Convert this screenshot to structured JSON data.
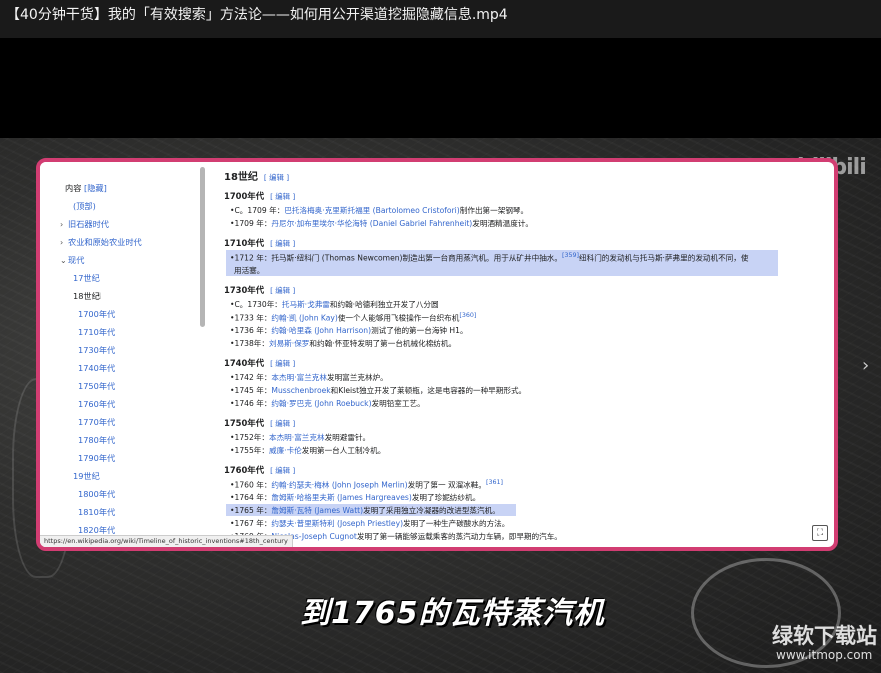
{
  "window": {
    "title": "【40分钟干货】我的「有效搜索」方法论——如何用公开渠道挖掘隐藏信息.mp4"
  },
  "toc": {
    "header": "内容",
    "hide": "[隐藏]",
    "items": {
      "top": "(顶部)",
      "paleolithic": "旧石器时代",
      "agri": "农业和原始农业时代",
      "modern": "现代",
      "c17": "17世纪",
      "c18": "18世纪",
      "d1700": "1700年代",
      "d1710": "1710年代",
      "d1730": "1730年代",
      "d1740": "1740年代",
      "d1750": "1750年代",
      "d1760": "1760年代",
      "d1770": "1770年代",
      "d1780": "1780年代",
      "d1790": "1790年代",
      "c19": "19世纪",
      "d1800": "1800年代",
      "d1810": "1810年代",
      "d1820": "1820年代"
    }
  },
  "article": {
    "edit": "[ 编辑 ]",
    "century": "18世纪",
    "s1700": {
      "heading": "1700年代",
      "items": [
        {
          "pre": "C。1709 年：",
          "lnk": "巴托洛梅奥·克里斯托福里 (Bartolomeo Cristofori)",
          "post": "制作出第一架钢琴。"
        },
        {
          "pre": "1709 年：",
          "lnk": "丹尼尔·加布里埃尔·华伦海特 (Daniel Gabriel Fahrenheit)",
          "post": "发明酒精温度计。"
        }
      ]
    },
    "s1710": {
      "heading": "1710年代",
      "line1": "1712 年：托马斯·纽科门 (Thomas Newcomen)制造出第一台商用蒸汽机。用于从矿井中抽水。",
      "ref": "[359]",
      "line1b": "纽科门的发动机与托马斯·萨弗里的发动机不同，使",
      "line2": "用活塞。"
    },
    "s1730": {
      "heading": "1730年代",
      "items": [
        {
          "pre": "C。1730年：",
          "lnk": "托马斯·戈弗雷",
          "post": "和约翰·哈德利独立开发了八分圆"
        },
        {
          "pre": "1733 年：",
          "lnk": "约翰·凯 (John Kay)",
          "post": "使一个人能够用飞梭操作一台织布机",
          "ref": "[360]"
        },
        {
          "pre": "1736 年：",
          "lnk": "约翰·哈里森 (John Harrison)",
          "post": "测试了他的第一台海钟 H1。"
        },
        {
          "pre": "1738年：",
          "lnk": "刘易斯·保罗",
          "post": "和约翰·怀亚特发明了第一台机械化棉纺机。"
        }
      ]
    },
    "s1740": {
      "heading": "1740年代",
      "items": [
        {
          "pre": "1742 年：",
          "lnk": "本杰明·富兰克林",
          "post": "发明富兰克林炉。"
        },
        {
          "pre": "1745 年：",
          "lnk": "Musschenbroek",
          "post": "和Kleist独立开发了莱顿瓶，这是电容器的一种早期形式。"
        },
        {
          "pre": "1746 年：",
          "lnk": "约翰·罗巴克 (John Roebuck)",
          "post": "发明铅室工艺。"
        }
      ]
    },
    "s1750": {
      "heading": "1750年代",
      "items": [
        {
          "pre": "1752年：",
          "lnk": "本杰明·富兰克林",
          "post": "发明避雷针。"
        },
        {
          "pre": "1755年：",
          "lnk": "威廉·卡伦",
          "post": "发明第一台人工制冷机。"
        }
      ]
    },
    "s1760": {
      "heading": "1760年代",
      "items": [
        {
          "pre": "1760 年：",
          "lnk": "约翰·约瑟夫·梅林 (John Joseph Merlin)",
          "post": "发明了第一 双溜冰鞋。",
          "ref": "[361]"
        },
        {
          "pre": "1764 年：",
          "lnk": "詹姆斯·哈格里夫斯 (James Hargreaves)",
          "post": "发明了珍妮纺纱机。"
        },
        {
          "pre": "1765 年：",
          "lnk": "詹姆斯·瓦特 (James Watt)",
          "post": "发明了采用独立冷凝器的改进型蒸汽机。",
          "hl": true
        },
        {
          "pre": "1767 年：",
          "lnk": "约瑟夫·普里斯特利 (Joseph Priestley)",
          "post": "发明了一种生产碳酸水的方法。"
        },
        {
          "pre": "1769 年：",
          "lnk": "Nicolas-Joseph Cugnot",
          "post": "发明了第一辆能够运载乘客的蒸汽动力车辆，即早期的汽车。"
        }
      ]
    }
  },
  "status_url": "https://en.wikipedia.org/wiki/Timeline_of_historic_inventions#18th_century",
  "logo": "bilibili",
  "subtitle": "到1765的瓦特蒸汽机",
  "watermark": {
    "site": "绿软下载站",
    "url": "www.itmop.com"
  },
  "icons": {
    "expand": "expand-icon",
    "next": "chevron-right-icon",
    "cursor": "hand-cursor-icon"
  }
}
